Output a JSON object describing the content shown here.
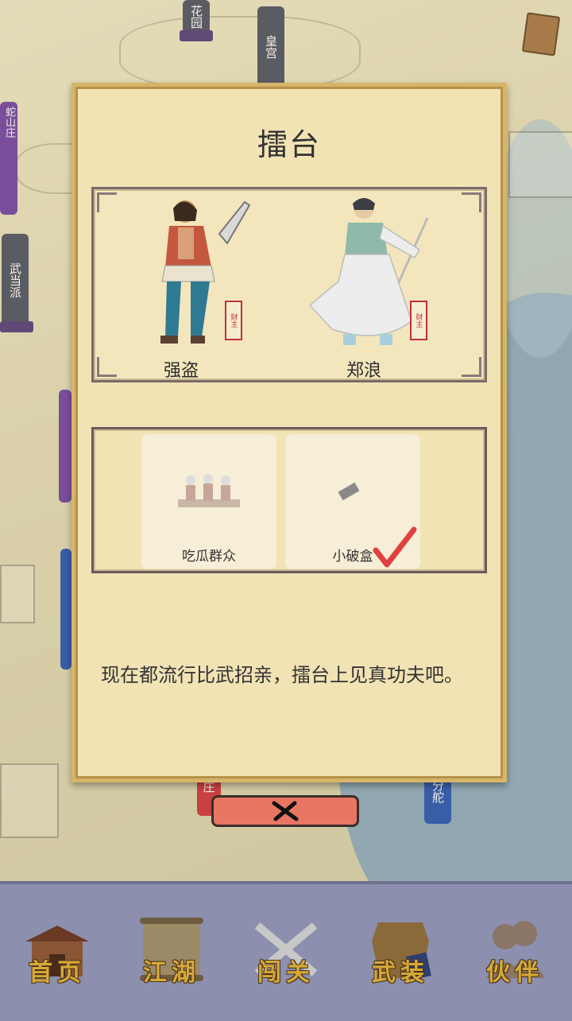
{
  "map": {
    "labels": {
      "garden": "花园",
      "palace": "皇宫",
      "wudang": "武当派",
      "snake": "蛇山庄",
      "zhuang": "庄",
      "branch": "分舵"
    },
    "colors": {
      "river": "#8aa3b3",
      "parchment": "#d9d0a9"
    }
  },
  "dialog": {
    "title": "擂台",
    "fighters": [
      {
        "name": "强盗",
        "seal": "财主"
      },
      {
        "name": "郑浪",
        "seal": "财主"
      }
    ],
    "items": [
      {
        "label": "吃瓜群众",
        "selected": false
      },
      {
        "label": "小破盒",
        "selected": true
      }
    ],
    "description": "现在都流行比武招亲，擂台上见真功夫吧。",
    "close_icon": "close-x-icon"
  },
  "nav": [
    {
      "label": "首页",
      "icon": "home-icon"
    },
    {
      "label": "江湖",
      "icon": "scroll-map-icon"
    },
    {
      "label": "闯关",
      "icon": "crossed-swords-icon"
    },
    {
      "label": "武装",
      "icon": "armor-icon"
    },
    {
      "label": "伙伴",
      "icon": "companions-icon"
    }
  ]
}
